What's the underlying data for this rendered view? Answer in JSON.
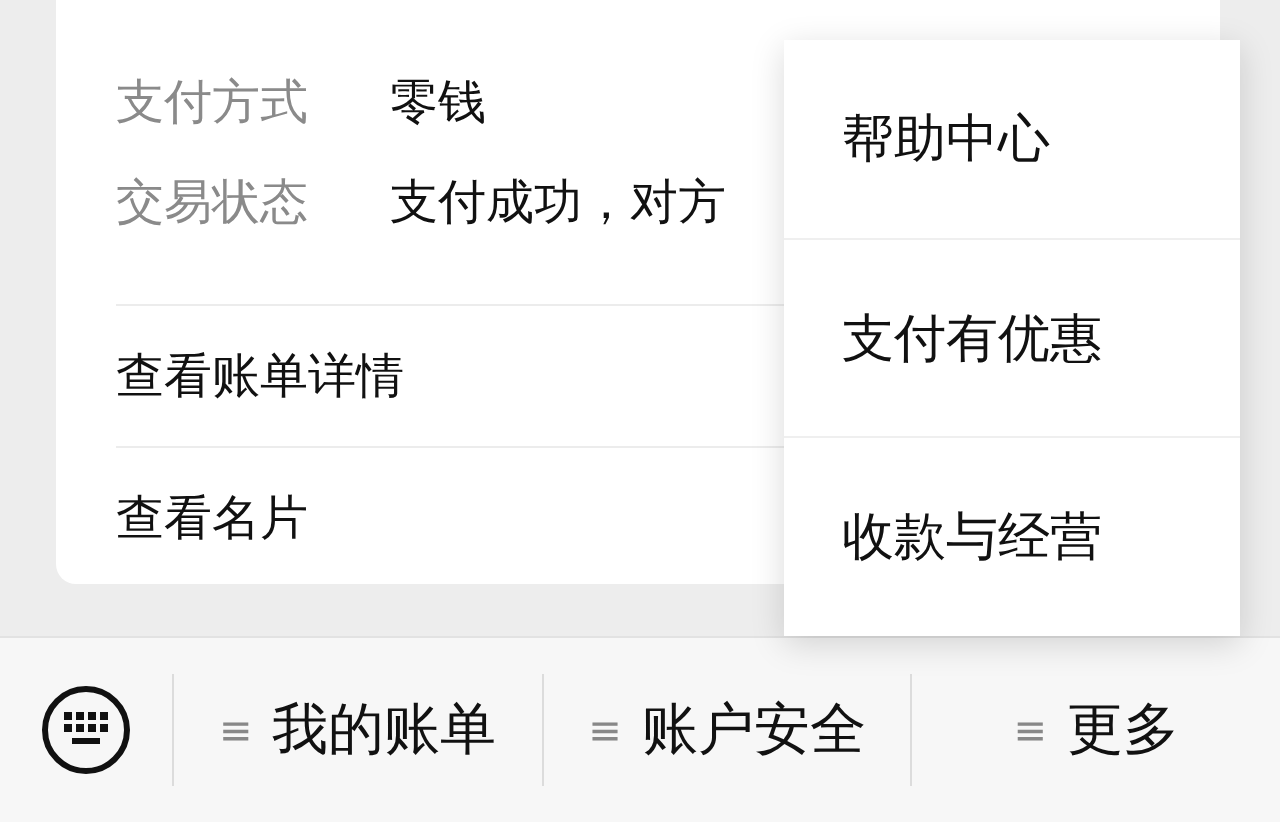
{
  "details": [
    {
      "label": "支付方式",
      "value": "零钱"
    },
    {
      "label": "交易状态",
      "value": "支付成功，对方"
    }
  ],
  "links": [
    "查看账单详情",
    "查看名片"
  ],
  "popup_menu": {
    "items": [
      "帮助中心",
      "支付有优惠",
      "收款与经营"
    ]
  },
  "bottom_bar": {
    "items": [
      {
        "icon": "≡",
        "label": "我的账单"
      },
      {
        "icon": "≡",
        "label": "账户安全"
      },
      {
        "icon": "≡",
        "label": "更多"
      }
    ]
  }
}
